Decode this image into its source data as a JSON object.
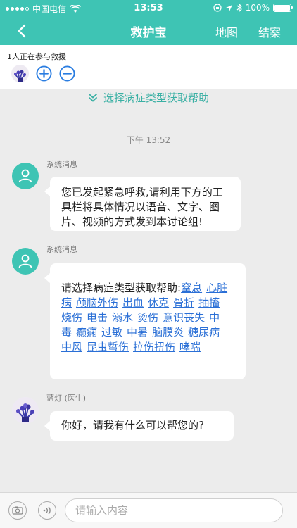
{
  "status_bar": {
    "carrier": "中国电信",
    "time": "13:53",
    "battery": "100%"
  },
  "nav": {
    "title": "救护宝",
    "map_label": "地图",
    "close_label": "结案"
  },
  "participants": {
    "count_text": "1人正在参与救援"
  },
  "help_link": "选择病症类型获取帮助",
  "timestamp": "下午 13:52",
  "messages": [
    {
      "sender": "系统消息",
      "text": "您已发起紧急呼救,请利用下方的工具栏将具体情况以语音、文字、图片、视频的方式发到本讨论组!"
    },
    {
      "sender": "系统消息",
      "prefix": "请选择病症类型获取帮助:",
      "links": [
        "窒息",
        "心脏病",
        "颅脑外伤",
        "出血",
        "休克",
        "骨折",
        "抽搐",
        "烧伤",
        "电击",
        "溺水",
        "烫伤",
        "意识丧失",
        "中毒",
        "癫痫",
        "过敏",
        "中暑",
        "脑膜炎",
        "糖尿病",
        "中风",
        "昆虫蜇伤",
        "拉伤扭伤",
        "哮喘"
      ]
    },
    {
      "sender": "蓝灯 (医生)",
      "text": "你好，请我有什么可以帮您的?"
    }
  ],
  "input": {
    "placeholder": "请输入内容"
  },
  "colors": {
    "accent": "#3ec4b4",
    "link": "#2a6fd6"
  }
}
